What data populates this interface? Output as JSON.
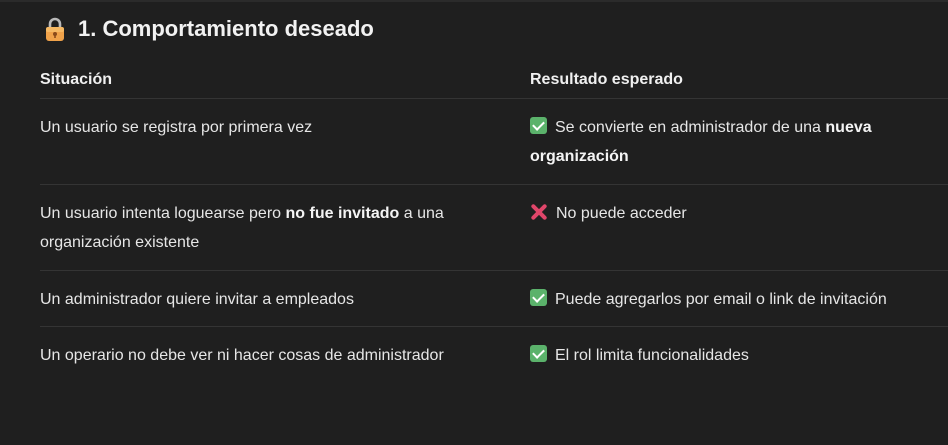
{
  "heading": {
    "title": "1. Comportamiento deseado",
    "icon": "lock-icon"
  },
  "table": {
    "headers": {
      "situation": "Situación",
      "result": "Resultado esperado"
    },
    "rows": [
      {
        "situation": "Un usuario se registra por primera vez",
        "result_pre": "Se convierte en administrador de una ",
        "result_bold": "nueva organización",
        "status": "check"
      },
      {
        "situation_pre": "Un usuario intenta loguearse pero ",
        "situation_bold": "no fue invitado",
        "situation_post": " a una organización existente",
        "result": "No puede acceder",
        "status": "cross"
      },
      {
        "situation": "Un administrador quiere invitar a empleados",
        "result": "Puede agregarlos por email o link de invitación",
        "status": "check"
      },
      {
        "situation": "Un operario no debe ver ni hacer cosas de administrador",
        "result": "El rol limita funcionalidades",
        "status": "check"
      }
    ]
  },
  "colors": {
    "background": "#1f1f1f",
    "check": "#5bb26b",
    "cross": "#e0466a"
  }
}
